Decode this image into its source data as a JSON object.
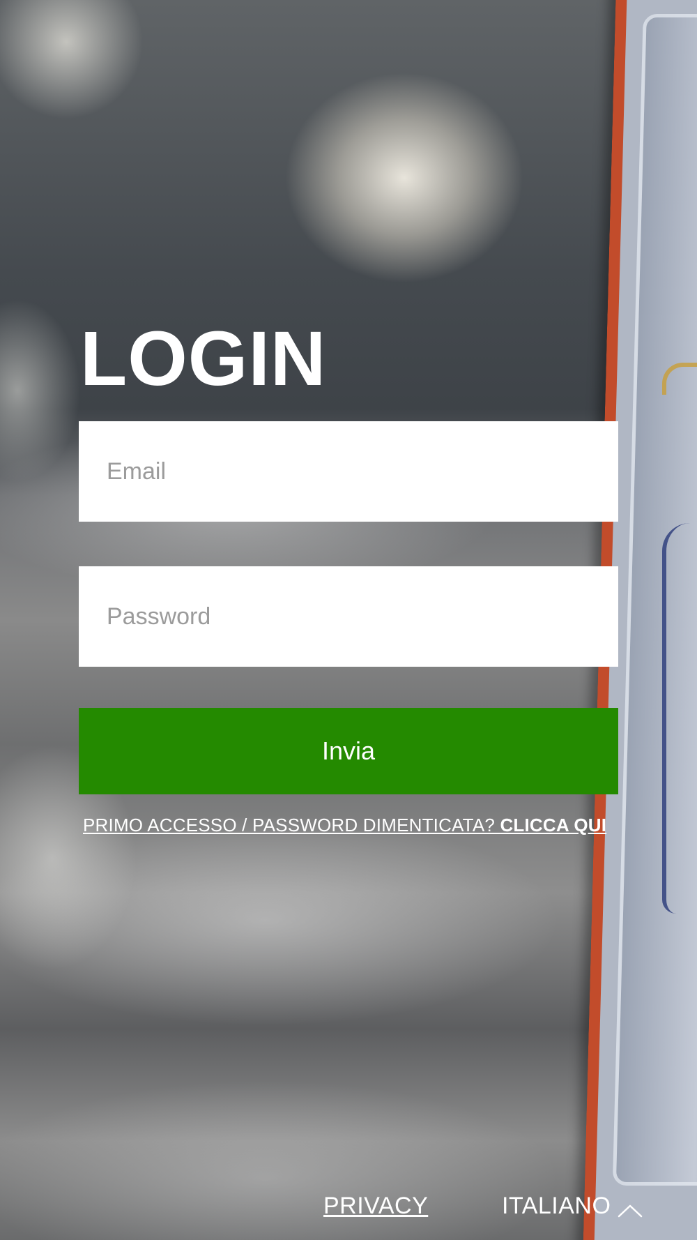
{
  "login": {
    "title": "LOGIN",
    "email_placeholder": "Email",
    "password_placeholder": "Password",
    "submit_label": "Invia",
    "first_access_text": "PRIMO ACCESSO / PASSWORD DIMENTICATA? ",
    "first_access_cta": "CLICCA QUI"
  },
  "footer": {
    "privacy_label": "PRIVACY",
    "language_label": "ITALIANO",
    "language_icon": "chevron-up-icon"
  },
  "colors": {
    "accent": "#248a00",
    "text": "#ffffff",
    "field_background": "#ffffff",
    "placeholder": "#9b9b9b"
  }
}
